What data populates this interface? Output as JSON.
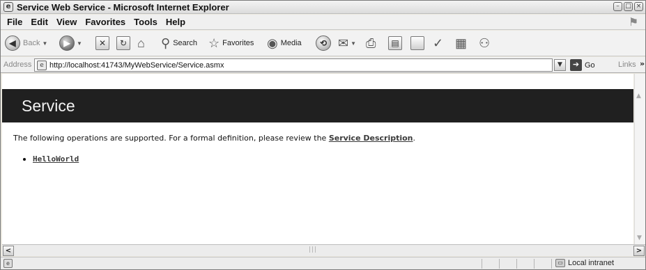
{
  "window": {
    "title": "Service Web Service - Microsoft Internet Explorer",
    "controls": [
      "minimize",
      "maximize",
      "close"
    ]
  },
  "menu": {
    "items": [
      "File",
      "Edit",
      "View",
      "Favorites",
      "Tools",
      "Help"
    ]
  },
  "toolbar": {
    "back_label": "Back",
    "search_label": "Search",
    "favorites_label": "Favorites",
    "media_label": "Media"
  },
  "address": {
    "label": "Address",
    "url": "http://localhost:41743/MyWebService/Service.asmx",
    "go_label": "Go",
    "links_label": "Links"
  },
  "page": {
    "banner_title": "Service",
    "description_prefix": "The following operations are supported. For a formal definition, please review the ",
    "description_link": "Service Description",
    "description_suffix": ".",
    "operations": [
      "HelloWorld"
    ]
  },
  "status": {
    "zone": "Local intranet"
  },
  "colors": {
    "banner_bg": "#202020",
    "banner_text": "#f2f2f2",
    "link": "#3a3a3a"
  }
}
